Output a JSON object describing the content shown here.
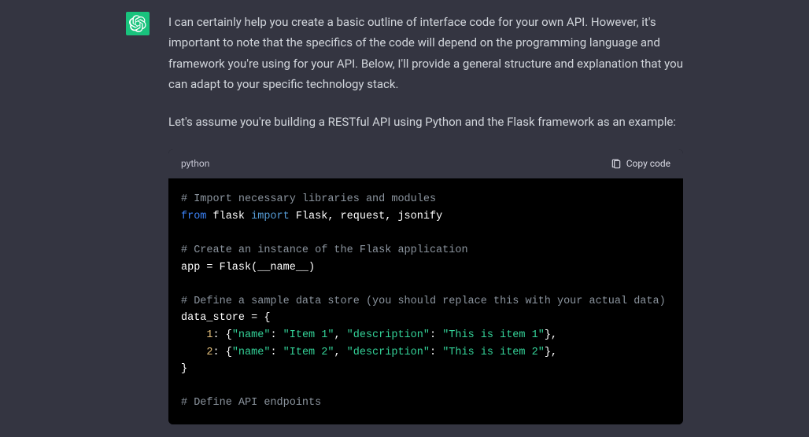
{
  "message": {
    "paragraph1": "I can certainly help you create a basic outline of interface code for your own API. However, it's important to note that the specifics of the code will depend on the programming language and framework you're using for your API. Below, I'll provide a general structure and explanation that you can adapt to your specific technology stack.",
    "paragraph2": "Let's assume you're building a RESTful API using Python and the Flask framework as an example:"
  },
  "codeblock": {
    "language": "python",
    "copy_label": "Copy code",
    "lines": {
      "c1": "# Import necessary libraries and modules",
      "l2_from": "from",
      "l2_flask": " flask ",
      "l2_import": "import",
      "l2_rest": " Flask, request, jsonify",
      "c3": "# Create an instance of the Flask application",
      "l4": "app = Flask(__name__)",
      "c5": "# Define a sample data store (you should replace this with your actual data)",
      "l6": "data_store = {",
      "l7_indent": "    ",
      "l7_num": "1",
      "l7_colon": ": {",
      "l7_k1": "\"name\"",
      "l7_sep1": ": ",
      "l7_v1": "\"Item 1\"",
      "l7_comma1": ", ",
      "l7_k2": "\"description\"",
      "l7_sep2": ": ",
      "l7_v2": "\"This is item 1\"",
      "l7_end": "},",
      "l8_num": "2",
      "l8_v1": "\"Item 2\"",
      "l8_v2": "\"This is item 2\"",
      "l9": "}",
      "c10": "# Define API endpoints"
    }
  }
}
